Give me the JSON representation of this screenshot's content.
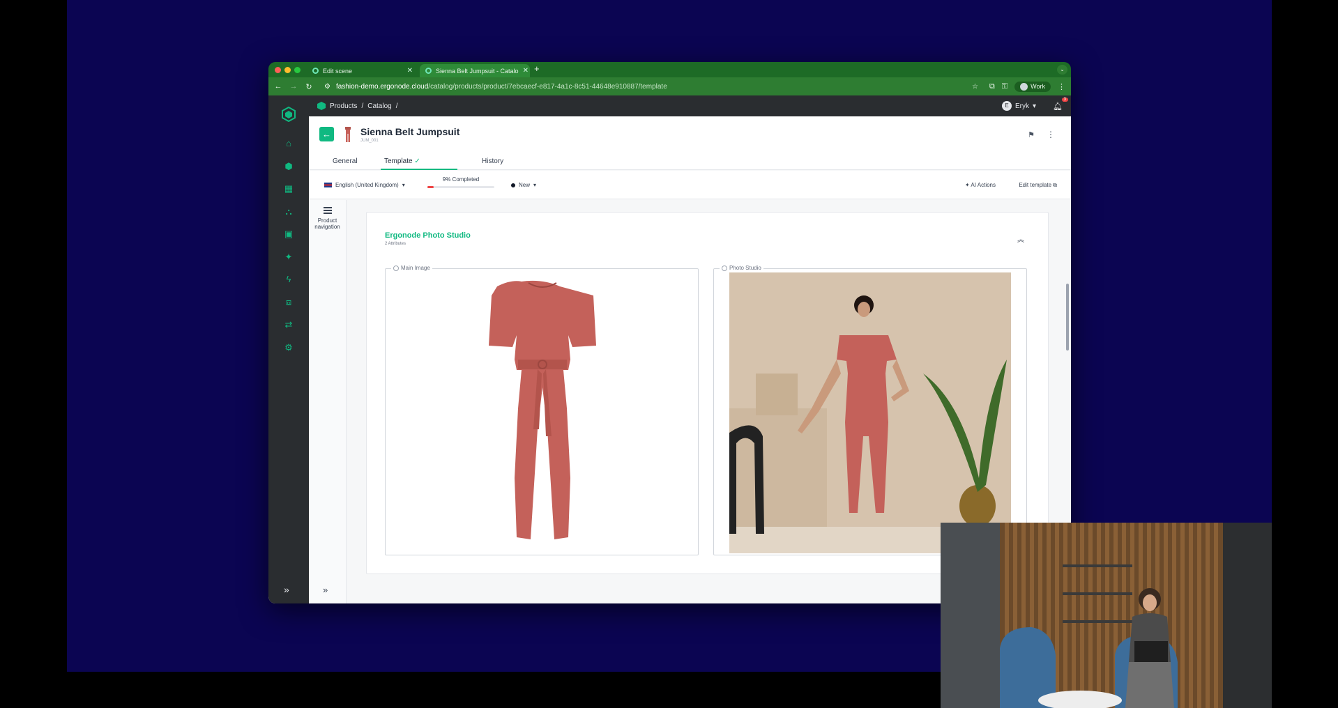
{
  "browser": {
    "tabs": [
      {
        "title": "Edit scene"
      },
      {
        "title": "Sienna Belt Jumpsuit - Catalo"
      }
    ],
    "url_host": "fashion-demo.ergonode.cloud",
    "url_path": "/catalog/products/product/7ebcaecf-e817-4a1c-8c51-44648e910887/template",
    "profile_label": "Work",
    "colors": {
      "tab_bar": "#1d6b26",
      "toolbar": "#2e7d32"
    }
  },
  "app": {
    "accent_color": "#10b981",
    "sidebar_icons": [
      "home-icon",
      "cube-icon",
      "dashboard-icon",
      "hierarchy-icon",
      "image-icon",
      "sparkle-icon",
      "bolt-icon",
      "integration-icon",
      "transform-icon",
      "settings-icon"
    ],
    "breadcrumb": [
      "Products",
      "/",
      "Catalog",
      "/"
    ],
    "user": {
      "initial": "E",
      "name": "Eryk"
    },
    "notifications_count": "3"
  },
  "product": {
    "name": "Sienna Belt Jumpsuit",
    "sku": "JUM_001",
    "tabs": [
      "General",
      "Template",
      "History"
    ],
    "template_check": "✓",
    "language": "English (United Kingdom)",
    "completion_label": "9% Completed",
    "completion_fraction": 0.09,
    "status": "New",
    "ai_actions_label": "AI Actions",
    "edit_template_label": "Edit template"
  },
  "product_navigation": {
    "label_line1": "Product",
    "label_line2": "navigation"
  },
  "section": {
    "title": "Ergonode Photo Studio",
    "subtitle": "2 Attributes",
    "fields": [
      {
        "label": "Main Image"
      },
      {
        "label": "Photo Studio"
      }
    ]
  }
}
